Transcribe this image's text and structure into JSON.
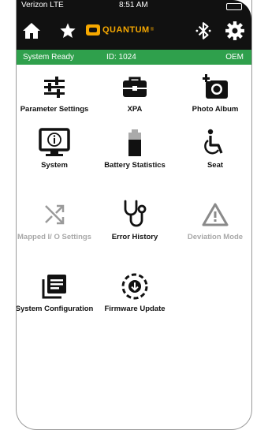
{
  "status_bar": {
    "carrier": "Verizon LTE",
    "time": "8:51 AM"
  },
  "header": {
    "logo_text": "QUANTUM",
    "logo_mark": "®"
  },
  "info_bar": {
    "status": "System Ready",
    "id": "ID: 1024",
    "mode": "OEM"
  },
  "menu": {
    "parameter_settings": "Parameter Settings",
    "xpa": "XPA",
    "photo_album": "Photo Album",
    "system": "System",
    "battery_statistics": "Battery Statistics",
    "seat": "Seat",
    "mapped_io_settings": "Mapped I/ O Settings",
    "error_history": "Error History",
    "deviation_mode": "Deviation Mode",
    "system_configuration": "System Configuration",
    "firmware_update": "Firmware Update"
  },
  "colors": {
    "accent_green": "#2fa04c",
    "logo_orange": "#f6a800",
    "disabled": "#a8a8a8"
  },
  "icons": [
    "home-icon",
    "star-icon",
    "bluetooth-icon",
    "gear-icon",
    "sliders-icon",
    "briefcase-icon",
    "add-photo-icon",
    "info-monitor-icon",
    "battery-icon",
    "wheelchair-icon",
    "shuffle-icon",
    "stethoscope-icon",
    "warning-icon",
    "document-list-icon",
    "download-circle-icon"
  ]
}
